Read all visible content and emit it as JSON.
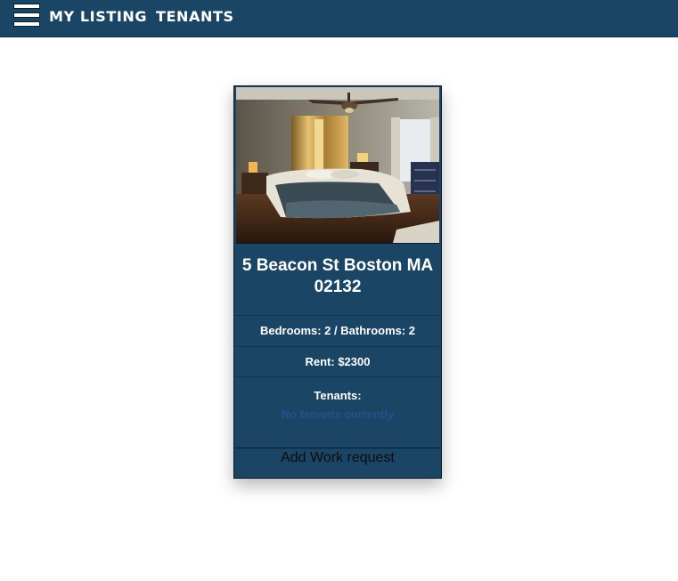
{
  "nav": {
    "menu_icon": "hamburger-menu-icon",
    "links": [
      "MY LISTING",
      "TENANTS"
    ]
  },
  "listing": {
    "photo_alt": "bedroom photo",
    "address": "5 Beacon St Boston MA 02132",
    "beds_baths": "Bedrooms: 2 / Bathrooms: 2",
    "rent": "Rent: $2300",
    "tenants_label": "Tenants:",
    "no_tenants": "No tenants currently",
    "work_request": "Add Work request"
  },
  "colors": {
    "navbar": "#1b4565",
    "card": "#1b4565",
    "no_tenants_text": "#27508a",
    "page_background": "#ffffff"
  }
}
